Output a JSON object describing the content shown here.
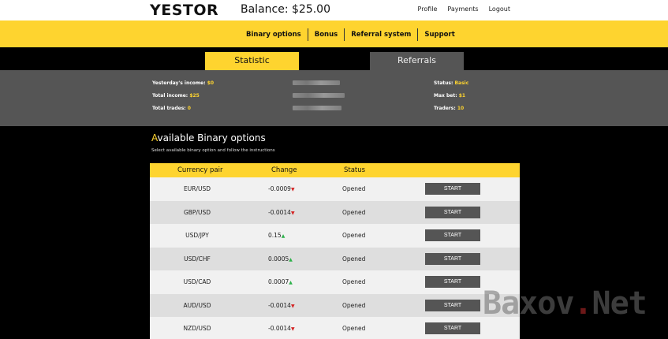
{
  "header": {
    "logo": "YESTOR",
    "balance": "Balance: $25.00",
    "links": [
      "Profile",
      "Payments",
      "Logout"
    ]
  },
  "nav": {
    "items": [
      "Binary options",
      "Bonus",
      "Referral system",
      "Support"
    ]
  },
  "tabs": {
    "statistic": "Statistic",
    "referrals": "Referrals"
  },
  "stats": {
    "yesterday_label": "Yesterday's income:",
    "yesterday_value": "$0",
    "total_income_label": "Total income:",
    "total_income_value": "$25",
    "total_trades_label": "Total trades:",
    "total_trades_value": "0",
    "status_label": "Status:",
    "status_value": "Basic",
    "max_bet_label": "Max bet:",
    "max_bet_value": "$1",
    "traders_label": "Traders:",
    "traders_value": "10"
  },
  "section": {
    "title_first": "A",
    "title_rest": "vailable Binary options",
    "subtitle": "Select available binary option and follow the instructions"
  },
  "table": {
    "headers": [
      "Currency pair",
      "Change",
      "Status"
    ],
    "rows": [
      {
        "pair": "EUR/USD",
        "change": "-0.0009",
        "dir": "down",
        "status": "Opened",
        "action": "START"
      },
      {
        "pair": "GBP/USD",
        "change": "-0.0014",
        "dir": "down",
        "status": "Opened",
        "action": "START"
      },
      {
        "pair": "USD/JPY",
        "change": "0.15",
        "dir": "up",
        "status": "Opened",
        "action": "START"
      },
      {
        "pair": "USD/CHF",
        "change": "0.0005",
        "dir": "up",
        "status": "Opened",
        "action": "START"
      },
      {
        "pair": "USD/CAD",
        "change": "0.0007",
        "dir": "up",
        "status": "Opened",
        "action": "START"
      },
      {
        "pair": "AUD/USD",
        "change": "-0.0014",
        "dir": "down",
        "status": "Opened",
        "action": "START"
      },
      {
        "pair": "NZD/USD",
        "change": "-0.0014",
        "dir": "down",
        "status": "Opened",
        "action": "START"
      }
    ]
  },
  "watermark": {
    "text_a": "Baxov",
    "dot": ".",
    "text_b": "Net"
  },
  "icons": {
    "up": "▲",
    "down": "▼"
  },
  "colors": {
    "accent": "#fed42f",
    "panel": "#555555",
    "up": "#2db14a",
    "down": "#d42323"
  }
}
